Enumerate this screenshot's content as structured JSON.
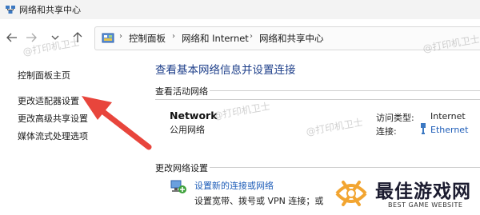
{
  "window": {
    "title": "网络和共享中心"
  },
  "nav": {
    "back_icon": "arrow-left-icon",
    "forward_icon": "arrow-right-icon",
    "recent_icon": "chevron-down-icon",
    "up_icon": "arrow-up-icon"
  },
  "breadcrumb": {
    "items": [
      "控制面板",
      "网络和 Internet",
      "网络和共享中心"
    ],
    "separator": "›"
  },
  "sidebar": {
    "items": [
      {
        "label": "控制面板主页"
      },
      {
        "label": "更改适配器设置"
      },
      {
        "label": "更改高级共享设置"
      },
      {
        "label": "媒体流式处理选项"
      }
    ]
  },
  "main": {
    "title": "查看基本网络信息并设置连接",
    "active_section": "查看活动网络",
    "network": {
      "name": "Network",
      "type": "公用网络",
      "access_label": "访问类型:",
      "access_value": "Internet",
      "connection_label": "连接:",
      "connection_value": "Ethernet"
    },
    "change_section": "更改网络设置",
    "setup": {
      "link": "设置新的连接或网络",
      "desc": "设置宽带、拨号或 VPN 连接；或"
    }
  },
  "watermarks": [
    "@打印机卫士",
    "@打印机卫士",
    "@打印机卫士",
    "@打印机卫士"
  ],
  "logo": {
    "title": "最佳游戏网",
    "subtitle": "BEST GAME WEBSITE"
  },
  "colors": {
    "link": "#1e5db8",
    "heading": "#1e3f8a",
    "arrow": "#e8453c"
  }
}
